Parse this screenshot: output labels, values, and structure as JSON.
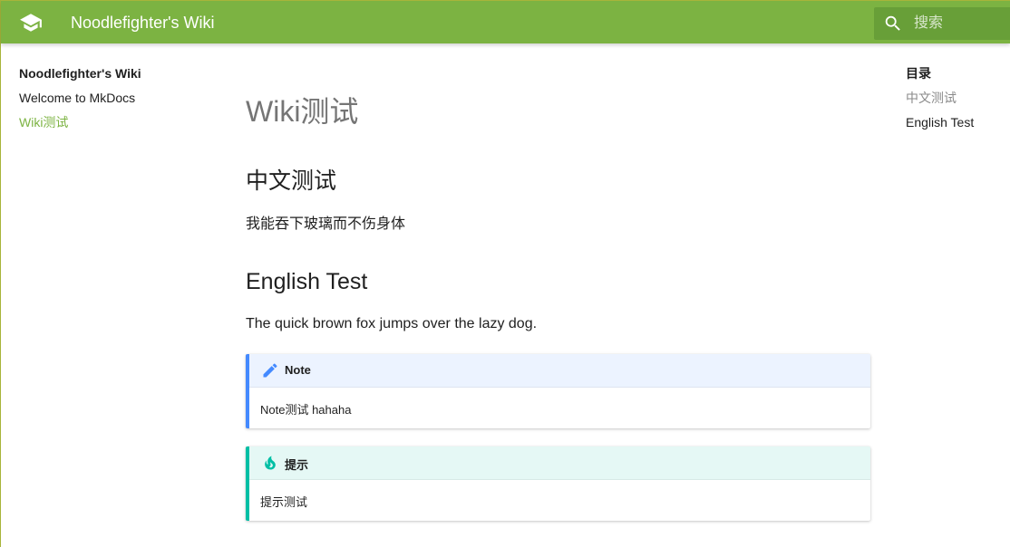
{
  "header": {
    "site_title": "Noodlefighter's Wiki",
    "search_placeholder": "搜索",
    "logo_icon": "graduation-cap-icon",
    "search_icon": "search-icon"
  },
  "nav": {
    "title": "Noodlefighter's Wiki",
    "items": [
      {
        "label": "Welcome to MkDocs",
        "active": false
      },
      {
        "label": "Wiki测试",
        "active": true
      }
    ]
  },
  "toc": {
    "title": "目录",
    "items": [
      {
        "label": "中文测试"
      },
      {
        "label": "English Test"
      }
    ]
  },
  "content": {
    "title": "Wiki测试",
    "sections": [
      {
        "heading": "中文测试",
        "text": "我能吞下玻璃而不伤身体"
      },
      {
        "heading": "English Test",
        "text": "The quick brown fox jumps over the lazy dog."
      }
    ],
    "admonitions": [
      {
        "type": "note",
        "icon": "pencil-icon",
        "title": "Note",
        "body": "Note测试 hahaha"
      },
      {
        "type": "tip",
        "icon": "flame-icon",
        "title": "提示",
        "body": "提示测试"
      }
    ]
  },
  "colors": {
    "primary": "#7cb342",
    "primary_dark": "#689f38",
    "note_accent": "#448aff",
    "tip_accent": "#00bfa5"
  }
}
